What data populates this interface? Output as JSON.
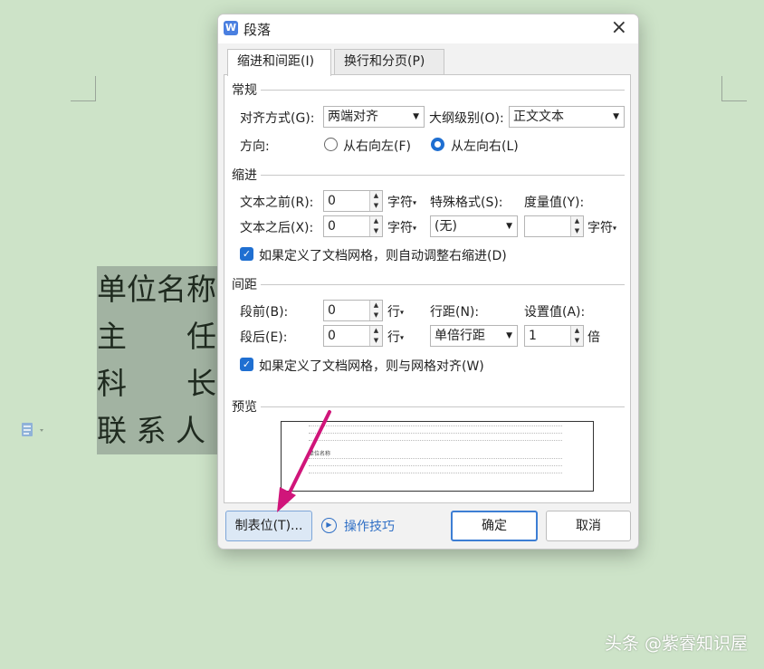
{
  "document": {
    "lines": [
      "单位名称",
      "主　　任",
      "科　　长",
      "联 系 人"
    ],
    "watermark": "头条 @紫睿知识屋"
  },
  "dialog": {
    "title": "段落",
    "app_icon": "W",
    "close_icon": "×",
    "tabs": [
      {
        "label": "缩进和间距(I)",
        "active": true
      },
      {
        "label": "换行和分页(P)",
        "active": false
      }
    ],
    "general": {
      "section": "常规",
      "alignment_label": "对齐方式(G):",
      "alignment_value": "两端对齐",
      "outline_label": "大纲级别(O):",
      "outline_value": "正文文本",
      "direction_label": "方向:",
      "rtl_label": "从右向左(F)",
      "ltr_label": "从左向右(L)",
      "direction_selected": "ltr"
    },
    "indent": {
      "section": "缩进",
      "before_label": "文本之前(R):",
      "before_value": "0",
      "before_unit": "字符",
      "after_label": "文本之后(X):",
      "after_value": "0",
      "after_unit": "字符",
      "special_label": "特殊格式(S):",
      "special_value": "(无)",
      "measure_label": "度量值(Y):",
      "measure_value": "",
      "measure_unit": "字符",
      "grid_checkbox_label": "如果定义了文档网格，则自动调整右缩进(D)",
      "grid_checked": true
    },
    "spacing": {
      "section": "间距",
      "before_label": "段前(B):",
      "before_value": "0",
      "before_unit": "行",
      "after_label": "段后(E):",
      "after_value": "0",
      "after_unit": "行",
      "line_label": "行距(N):",
      "line_value": "单倍行距",
      "setting_label": "设置值(A):",
      "setting_value": "1",
      "setting_unit": "倍",
      "grid_checkbox_label": "如果定义了文档网格，则与网格对齐(W)",
      "grid_checked": true
    },
    "preview": {
      "section": "预览",
      "sample_text": "单位名称"
    },
    "buttons": {
      "tabs_button": "制表位(T)...",
      "tips": "操作技巧",
      "ok": "确定",
      "cancel": "取消"
    }
  },
  "colors": {
    "background": "#cde3c8",
    "accent": "#1f6fd1",
    "arrow": "#d0157a"
  }
}
